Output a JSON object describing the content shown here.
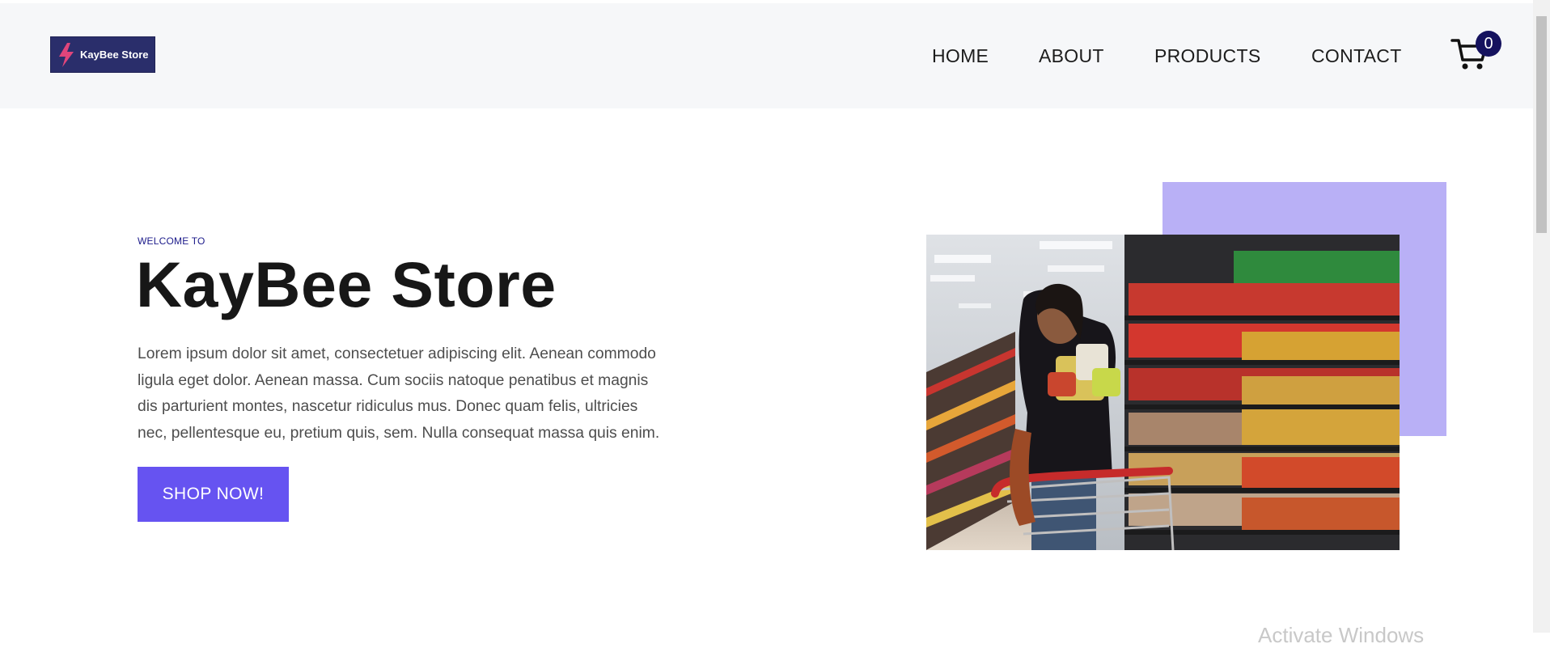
{
  "brand": {
    "logo_text": "KayBee Store"
  },
  "nav": {
    "items": [
      "HOME",
      "ABOUT",
      "PRODUCTS",
      "CONTACT"
    ],
    "cart_count": "0"
  },
  "hero": {
    "eyebrow": "WELCOME TO",
    "title": "KayBee Store",
    "description_lines": [
      "Lorem ipsum dolor sit amet, consectetuer adipiscing elit. Aenean commodo",
      "ligula eget dolor. Aenean massa. Cum sociis natoque penatibus et magnis",
      "dis parturient montes, nascetur ridiculus mus. Donec quam felis, ultricies",
      "nec, pellentesque eu, pretium quis, sem. Nulla consequat massa quis enim."
    ],
    "cta_label": "SHOP NOW!"
  },
  "overlay": {
    "watermark": "Activate Windows"
  },
  "colors": {
    "accent": "#6653f1",
    "accent_light": "#b9b0f6",
    "header_bg": "#f6f7f9",
    "badge_bg": "#15125e",
    "logo_bg": "#2a2e6b",
    "bolt": "#e0457b"
  },
  "icons": {
    "cart": "cart-icon",
    "logo_bolt": "lightning-bolt-icon"
  }
}
